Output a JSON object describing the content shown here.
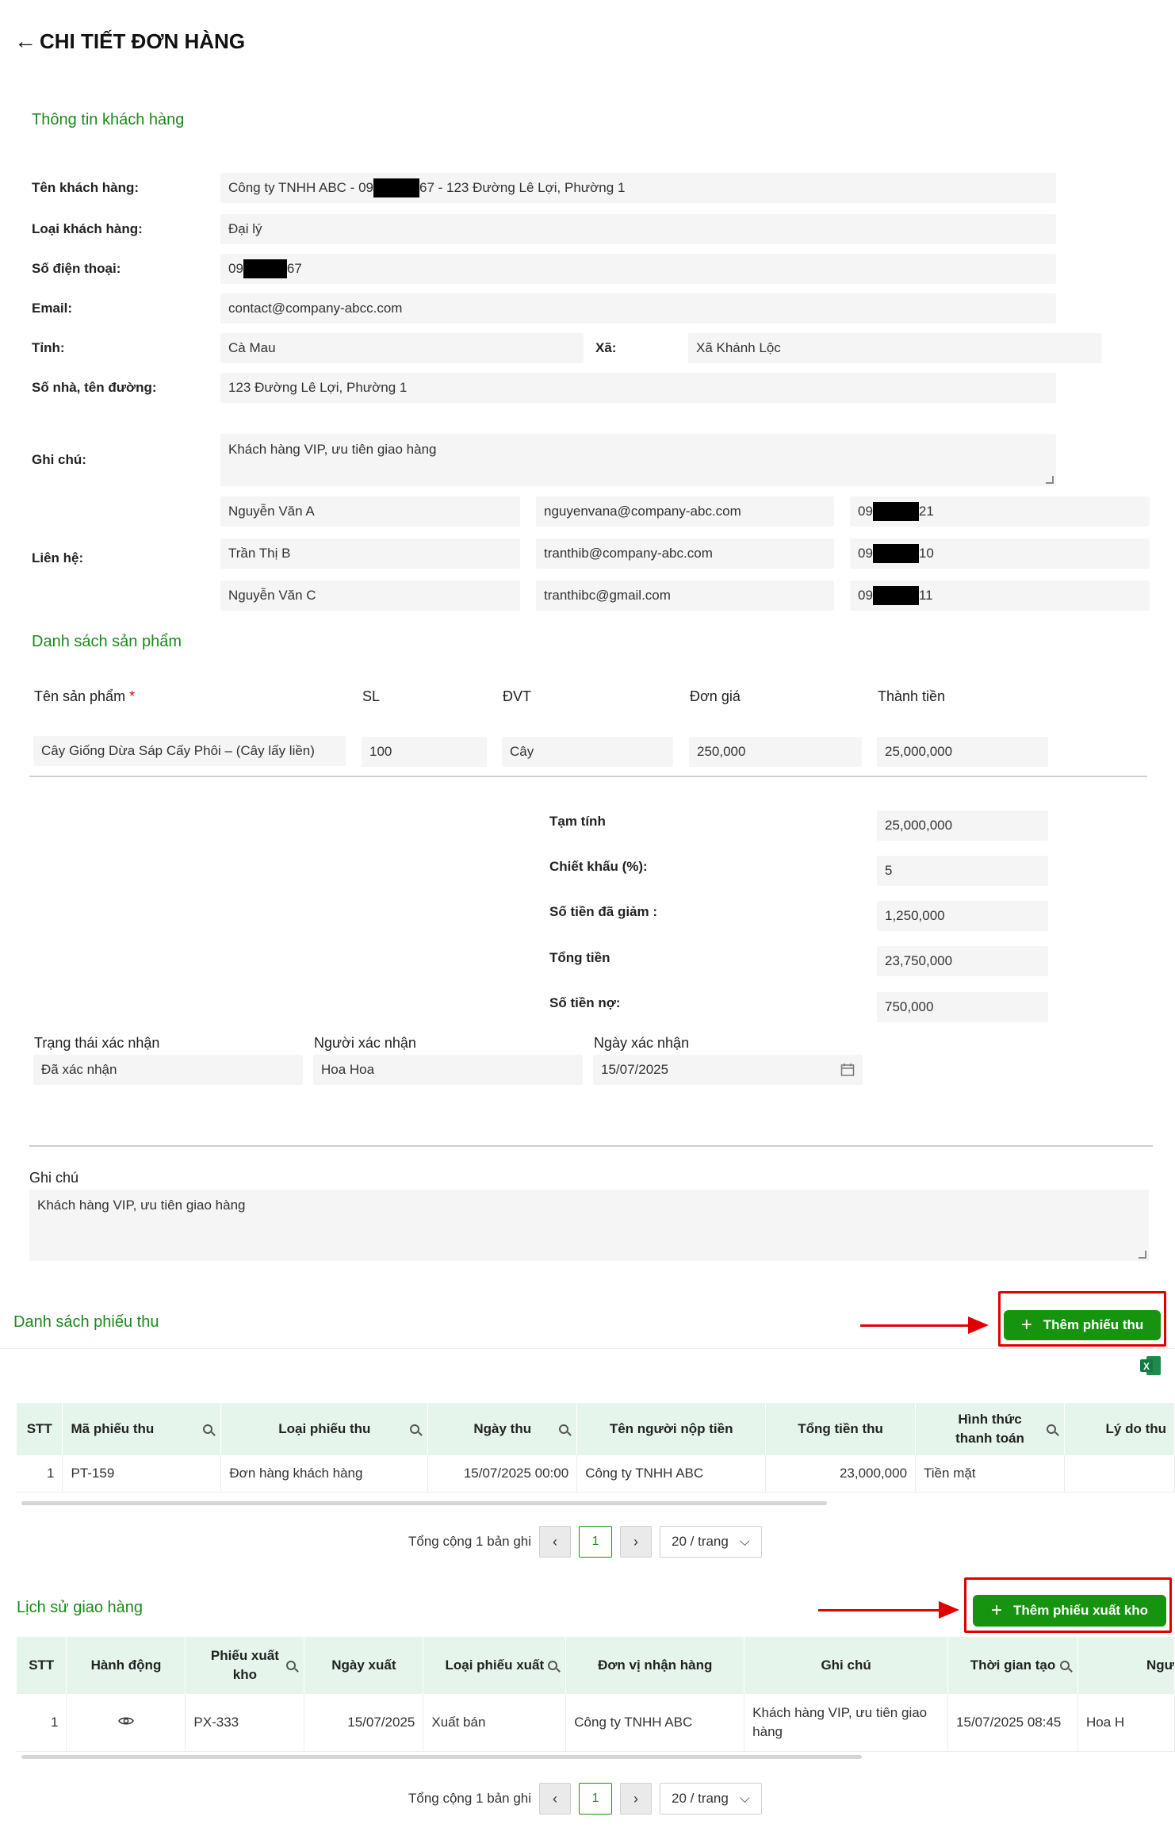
{
  "header": {
    "title": "CHI TIẾT ĐƠN HÀNG"
  },
  "customer": {
    "section_title": "Thông tin khách hàng",
    "name_label": "Tên khách hàng:",
    "name_prefix": "Công ty TNHH ABC - 09",
    "name_suffix": "67 - 123 Đường Lê Lợi, Phường 1",
    "type_label": "Loại khách hàng:",
    "type_value": "Đại lý",
    "phone_label": "Số điện thoại:",
    "phone_prefix": "09",
    "phone_suffix": "67",
    "email_label": "Email:",
    "email_value": "contact@company-abcc.com",
    "province_label": "Tỉnh:",
    "province_value": "Cà Mau",
    "ward_label": "Xã:",
    "ward_value": "Xã Khánh Lộc",
    "street_label": "Số nhà, tên đường:",
    "street_value": "123 Đường Lê Lợi, Phường 1",
    "note_label": "Ghi chú:",
    "note_value": "Khách hàng VIP, ưu tiên giao hàng",
    "contacts_label": "Liên hệ:",
    "contacts": [
      {
        "name": "Nguyễn Văn A",
        "email": "nguyenvana@company-abc.com",
        "phone_prefix": "09",
        "phone_suffix": "21"
      },
      {
        "name": "Trần Thị B",
        "email": "tranthib@company-abc.com",
        "phone_prefix": "09",
        "phone_suffix": "10"
      },
      {
        "name": "Nguyễn Văn C",
        "email": "tranthibc@gmail.com",
        "phone_prefix": "09",
        "phone_suffix": "11"
      }
    ]
  },
  "products": {
    "section_title": "Danh sách sản phẩm",
    "headers": {
      "name": "Tên sản phẩm",
      "required_mark": "*",
      "qty": "SL",
      "unit": "ĐVT",
      "price": "Đơn giá",
      "total": "Thành tiền"
    },
    "row": {
      "name": "Cây Giống Dừa Sáp Cấy Phôi – (Cây lấy liền)",
      "qty": "100",
      "unit": "Cây",
      "price": "250,000",
      "total": "25,000,000"
    }
  },
  "summary": {
    "subtotal_label": "Tạm tính",
    "subtotal": "25,000,000",
    "discount_label": "Chiết khấu (%):",
    "discount": "5",
    "discount_amount_label": "Số tiền đã giảm :",
    "discount_amount": "1,250,000",
    "total_label": "Tổng tiền",
    "total": "23,750,000",
    "debt_label": "Số tiền nợ:",
    "debt": "750,000"
  },
  "confirm": {
    "status_label": "Trạng thái xác nhận",
    "status": "Đã xác nhận",
    "person_label": "Người xác nhận",
    "person": "Hoa Hoa",
    "date_label": "Ngày xác nhận",
    "date": "15/07/2025"
  },
  "order_note": {
    "label": "Ghi chú",
    "value": "Khách hàng VIP, ưu tiên giao hàng"
  },
  "receipts": {
    "section_title": "Danh sách phiếu thu",
    "add_button": "Thêm phiếu thu",
    "headers": [
      "STT",
      "Mã phiếu thu",
      "Loại phiếu thu",
      "Ngày thu",
      "Tên người nộp tiền",
      "Tổng tiền thu",
      "Hình thức thanh toán",
      "Lý do thu"
    ],
    "rows": [
      {
        "stt": "1",
        "code": "PT-159",
        "type": "Đơn hàng khách hàng",
        "date": "15/07/2025 00:00",
        "payer": "Công ty TNHH ABC",
        "amount": "23,000,000",
        "method": "Tiền mặt",
        "reason": ""
      }
    ],
    "pager": {
      "total": "Tổng cộng 1 bản ghi",
      "page": "1",
      "size": "20 / trang"
    }
  },
  "delivery": {
    "section_title": "Lịch sử giao hàng",
    "add_button": "Thêm phiếu xuất kho",
    "headers": [
      "STT",
      "Hành động",
      "Phiếu xuất kho",
      "Ngày xuất",
      "Loại phiếu xuất",
      "Đơn vị nhận hàng",
      "Ghi chú",
      "Thời gian tạo",
      "Ngư"
    ],
    "rows": [
      {
        "stt": "1",
        "code": "PX-333",
        "date": "15/07/2025",
        "type": "Xuất bán",
        "receiver": "Công ty TNHH ABC",
        "note": "Khách hàng VIP, ưu tiên giao hàng",
        "created": "15/07/2025 08:45",
        "creator": "Hoa H"
      }
    ],
    "pager": {
      "total": "Tổng cộng 1 bản ghi",
      "page": "1",
      "size": "20 / trang"
    }
  },
  "colors": {
    "accent": "#17940f",
    "section": "#1a8a1a",
    "table_header": "#e5f5ec",
    "highlight": "#e00000"
  },
  "icons": [
    "back-arrow-icon",
    "calendar-icon",
    "plus-icon",
    "excel-icon",
    "search-icon",
    "eye-icon",
    "chevron-left-icon",
    "chevron-right-icon",
    "chevron-down-icon"
  ]
}
